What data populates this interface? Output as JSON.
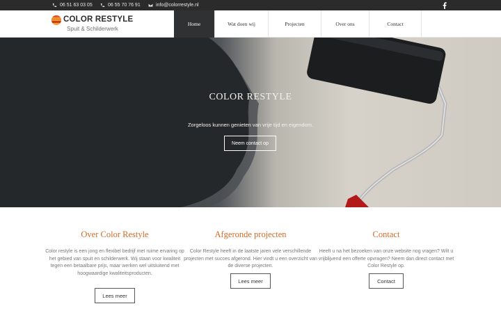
{
  "topbar": {
    "phone1": "06 51 63 03 05",
    "phone2": "06 55 70 76 91",
    "email": "info@colorrestyle.nl",
    "social_icon": "facebook-icon"
  },
  "header": {
    "logo_name": "COLOR RESTYLE",
    "logo_tagline": "Spuit & Schilderwerk",
    "nav": [
      {
        "label": "Home",
        "active": true
      },
      {
        "label": "Wat doen wij",
        "active": false
      },
      {
        "label": "Projecten",
        "active": false
      },
      {
        "label": "Over ons",
        "active": false
      },
      {
        "label": "Contact",
        "active": false
      }
    ]
  },
  "hero": {
    "title": "COLOR RESTYLE",
    "subtitle": "Zorgeloos kunnen genieten van vrije tijd en eigendom.",
    "cta_label": "Neem contact op"
  },
  "sections": [
    {
      "title": "Over Color Restyle",
      "text": "Color restyle is een jong en flexibel bedrijf met ruime ervaring op het gebied van spuit en schilderwerk. Wij staan voor kwaliteit tegen een betaalbare prijs, maar werken wel uitsluitend met hoogwaardige kwaliteitsproducten.",
      "button": "Lees meer"
    },
    {
      "title": "Afgeronde projecten",
      "text": "Color Restyle heeft in de laatste jaren vele verschillende projecten met succes afgerond. Hier vindt u een overzicht van de diverse projecten.",
      "button": "Lees meer"
    },
    {
      "title": "Contact",
      "text": "Heeft u na het bezoeken van onze website nog vragen? Wilt u vrijblijvend een offerte opvragen? Neem dan direct contact met Color Restyle op.",
      "button": "Contact"
    }
  ],
  "colors": {
    "accent": "#d46a24",
    "topbar": "#2b2b2b",
    "nav_active": "#2f3133"
  }
}
